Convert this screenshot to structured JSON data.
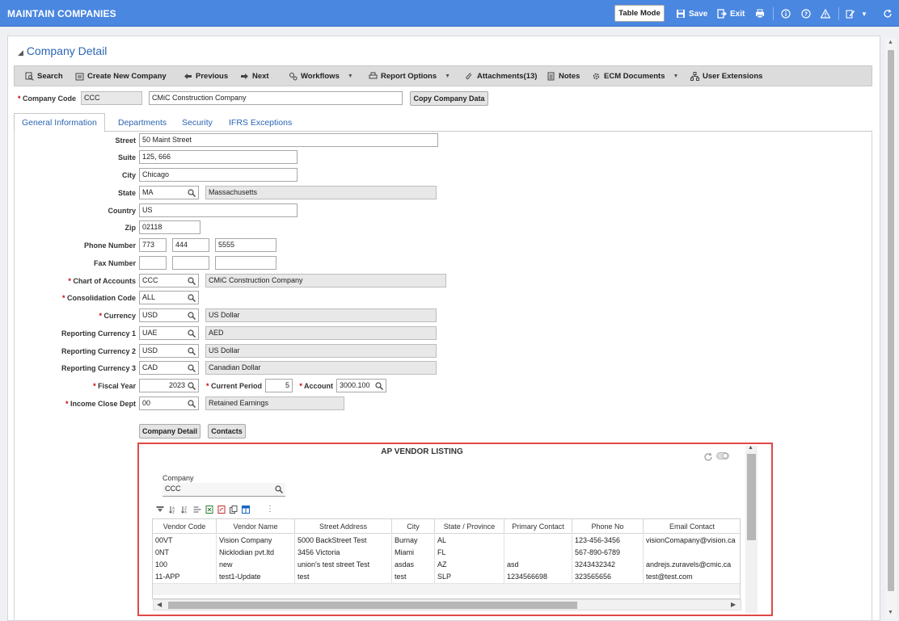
{
  "app": {
    "title": "MAINTAIN COMPANIES",
    "table_mode_label": "Table Mode",
    "save_label": "Save",
    "exit_label": "Exit"
  },
  "section": {
    "title": "Company Detail"
  },
  "toolbar": {
    "search": "Search",
    "create": "Create New Company",
    "previous": "Previous",
    "next": "Next",
    "workflows": "Workflows",
    "report_options": "Report Options",
    "attachments": "Attachments(13)",
    "notes": "Notes",
    "ecm": "ECM Documents",
    "user_ext": "User Extensions"
  },
  "company": {
    "code_label": "Company Code",
    "code": "CCC",
    "name": "CMiC Construction Company",
    "copy_label": "Copy Company Data"
  },
  "tabs": [
    "General Information",
    "Departments",
    "Security",
    "IFRS Exceptions"
  ],
  "form": {
    "street_label": "Street",
    "street": "50 Maint Street",
    "suite_label": "Suite",
    "suite": "125, 666",
    "city_label": "City",
    "city": "Chicago",
    "state_label": "State",
    "state": "MA",
    "state_name": "Massachusetts",
    "country_label": "Country",
    "country": "US",
    "zip_label": "Zip",
    "zip": "02118",
    "phone_label": "Phone Number",
    "phone1": "773",
    "phone2": "444",
    "phone3": "5555",
    "fax_label": "Fax Number",
    "coa_label": "Chart of Accounts",
    "coa": "CCC",
    "coa_name": "CMiC Construction Company",
    "cons_label": "Consolidation Code",
    "cons": "ALL",
    "currency_label": "Currency",
    "currency": "USD",
    "currency_name": "US Dollar",
    "rc1_label": "Reporting Currency 1",
    "rc1": "UAE",
    "rc1_name": "AED",
    "rc2_label": "Reporting Currency 2",
    "rc2": "USD",
    "rc2_name": "US Dollar",
    "rc3_label": "Reporting Currency 3",
    "rc3": "CAD",
    "rc3_name": "Canadian Dollar",
    "fy_label": "Fiscal Year",
    "fy": "2023",
    "cp_label": "Current Period",
    "cp": "5",
    "acct_label": "Account",
    "acct": "3000.100",
    "icd_label": "Income Close Dept",
    "icd": "00",
    "icd_name": "Retained Earnings"
  },
  "buttons": {
    "company_detail": "Company Detail",
    "contacts": "Contacts"
  },
  "ap": {
    "title": "AP VENDOR LISTING",
    "company_label": "Company",
    "company": "CCC",
    "columns": [
      "Vendor Code",
      "Vendor Name",
      "Street Address",
      "City",
      "State / Province",
      "Primary Contact",
      "Phone No",
      "Email Contact"
    ],
    "rows": [
      [
        "00VT",
        "Vision Company",
        "5000 BackStreet Test",
        "Burnay",
        "AL",
        "",
        "123-456-3456",
        "visionComapany@vision.ca"
      ],
      [
        "0NT",
        "Nicklodian pvt.ltd",
        "3456 Victoria",
        "Miami",
        "FL",
        "",
        "567-890-6789",
        ""
      ],
      [
        "100",
        "new",
        "union's test street Test",
        "asdas",
        "AZ",
        "asd",
        "3243432342",
        "andrejs.zuravels@cmic.ca"
      ],
      [
        "11-APP",
        "test1-Update",
        "test",
        "test",
        "SLP",
        "1234566698",
        "323565656",
        "test@test.com"
      ]
    ]
  },
  "colors": {
    "header": "#4a87e0",
    "link": "#2a65b3",
    "highlight": "#e04848"
  }
}
